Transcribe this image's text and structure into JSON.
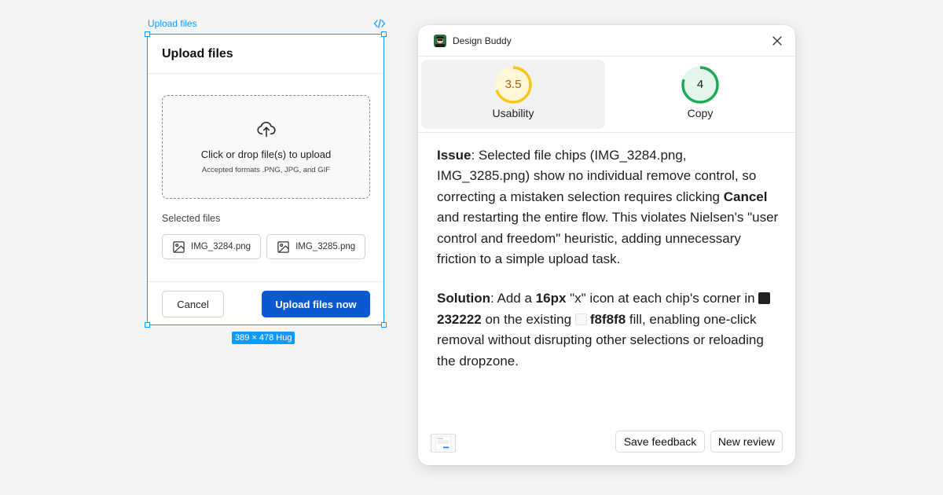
{
  "canvas": {
    "frame_label": "Upload files",
    "size_badge": "389 × 478 Hug"
  },
  "upload_modal": {
    "title": "Upload files",
    "dropzone_title": "Click or drop file(s) to upload",
    "dropzone_subtitle": "Accepted formats .PNG, JPG, and GIF",
    "selected_label": "Selected files",
    "files": [
      "IMG_3284.png",
      "IMG_3285.png"
    ],
    "cancel_label": "Cancel",
    "upload_label": "Upload files now",
    "primary_color": "#0a59d0"
  },
  "panel": {
    "title": "Design Buddy",
    "scores": [
      {
        "label": "Usability",
        "value": "3.5",
        "score": 3.5,
        "max": 5,
        "color": "#f5c518",
        "fill": "#fff6d6",
        "text_color": "#a0611a"
      },
      {
        "label": "Copy",
        "value": "4",
        "score": 4,
        "max": 5,
        "color": "#1fa855",
        "fill": "#e3f6e9",
        "text_color": "#1e1e1e"
      }
    ],
    "issue": {
      "label": "Issue",
      "text1": ": Selected file chips (IMG_3284.png, IMG_3285.png) show no individual remove control, so correcting a mistaken selection requires clicking ",
      "bold1": "Cancel",
      "text2": " and restarting the entire flow. This violates Nielsen's \"user control and freedom\" heuristic, adding unnecessary friction to a simple upload task."
    },
    "solution": {
      "label": "Solution",
      "text1": ": Add a ",
      "bold1": "16px",
      "text2": " \"x\" icon at each chip's corner in ",
      "color1_name": "232222",
      "color1": "#232222",
      "text3": " on the existing ",
      "color2_name": "f8f8f8",
      "color2": "#f8f8f8",
      "text4": " fill, enabling one-click removal without disrupting other selections or reloading the dropzone."
    },
    "save_label": "Save feedback",
    "new_label": "New review"
  }
}
